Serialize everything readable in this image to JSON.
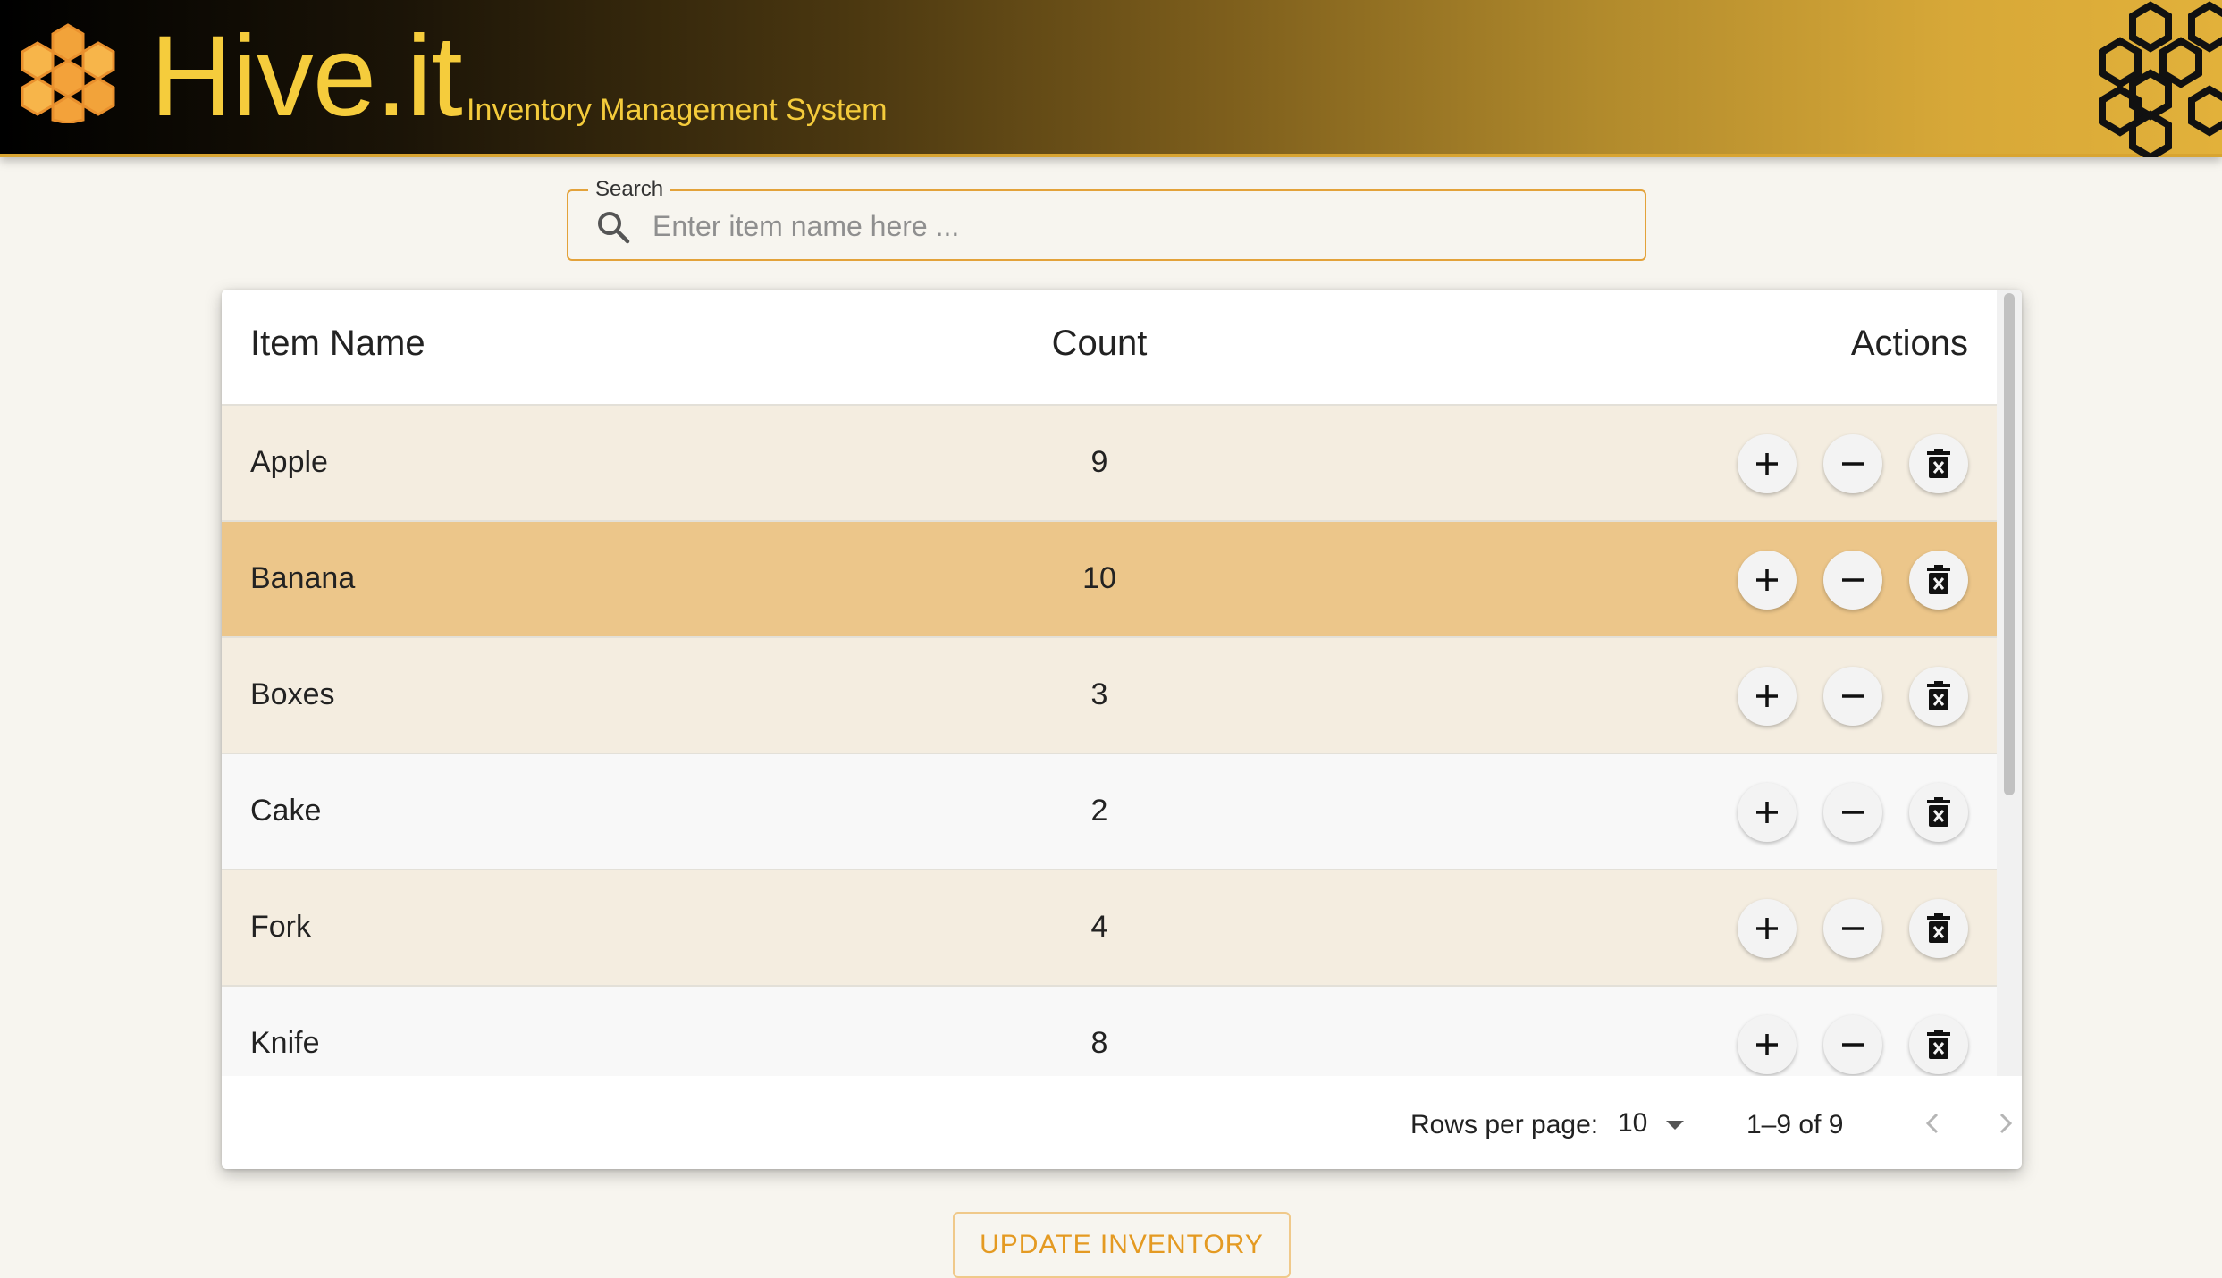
{
  "header": {
    "brand": "Hive.it",
    "subtitle": "Inventory Management System",
    "logo_left_icon": "honeycomb-logo-icon",
    "logo_right_icon": "honeycomb-outline-icon"
  },
  "search": {
    "label": "Search",
    "placeholder": "Enter item name here ...",
    "value": "",
    "icon": "search-icon"
  },
  "table": {
    "columns": {
      "name": "Item Name",
      "count": "Count",
      "actions": "Actions"
    },
    "rows": [
      {
        "name": "Apple",
        "count": "9"
      },
      {
        "name": "Banana",
        "count": "10"
      },
      {
        "name": "Boxes",
        "count": "3"
      },
      {
        "name": "Cake",
        "count": "2"
      },
      {
        "name": "Fork",
        "count": "4"
      },
      {
        "name": "Knife",
        "count": "8"
      }
    ],
    "action_icons": [
      "add-icon",
      "remove-icon",
      "delete-icon"
    ]
  },
  "pagination": {
    "rows_per_page_label": "Rows per page:",
    "rows_per_page_value": "10",
    "range": "1–9 of 9"
  },
  "update_button": "UPDATE INVENTORY",
  "colors": {
    "accent": "#e3a23a",
    "brand_text": "#f5cc3c",
    "row_cream": "#f4ede0",
    "row_highlight": "#ecc68a",
    "button_text": "#e49a22"
  }
}
